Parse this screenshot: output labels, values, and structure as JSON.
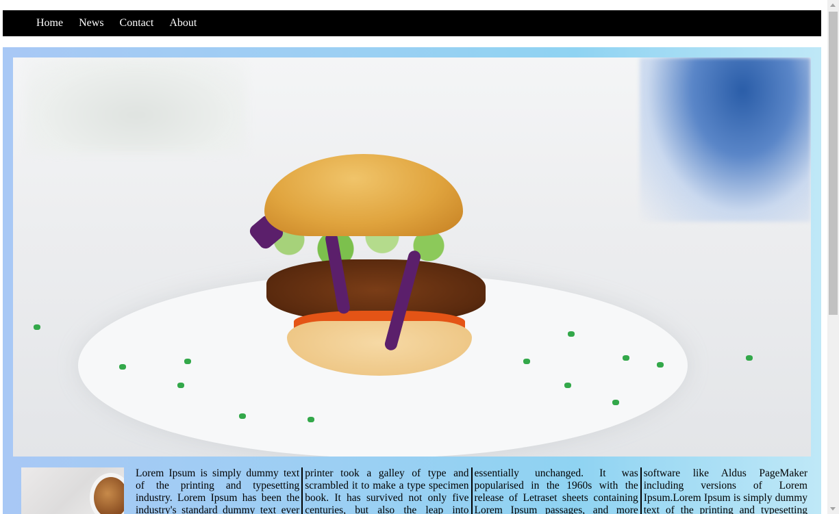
{
  "nav": {
    "items": [
      {
        "label": "Home"
      },
      {
        "label": "News"
      },
      {
        "label": "Contact"
      },
      {
        "label": "About"
      }
    ]
  },
  "hero": {
    "image": "burger-photo"
  },
  "article": {
    "thumbnail": "food-thumbnail-image",
    "text": "Lorem Ipsum is simply dummy text of the printing and typesetting industry. Lorem Ipsum has been the industry's standard dummy text ever since the 1500s, when an unknown printer took a galley of type and scrambled it to make a type specimen book. It has survived not only five centuries, but also the leap into electronic typesetting, remaining essentially unchanged. It was popularised in the 1960s with the release of Letraset sheets containing Lorem Ipsum passages, and more recently with desktop publishing software like Aldus PageMaker including versions of Lorem Ipsum.Lorem Ipsum is simply dummy text of the printing and typesetting industry."
  },
  "colors": {
    "navbar": "#000000",
    "content_gradient_start": "#a8c8f5",
    "content_gradient_end": "#bfe8f7"
  }
}
